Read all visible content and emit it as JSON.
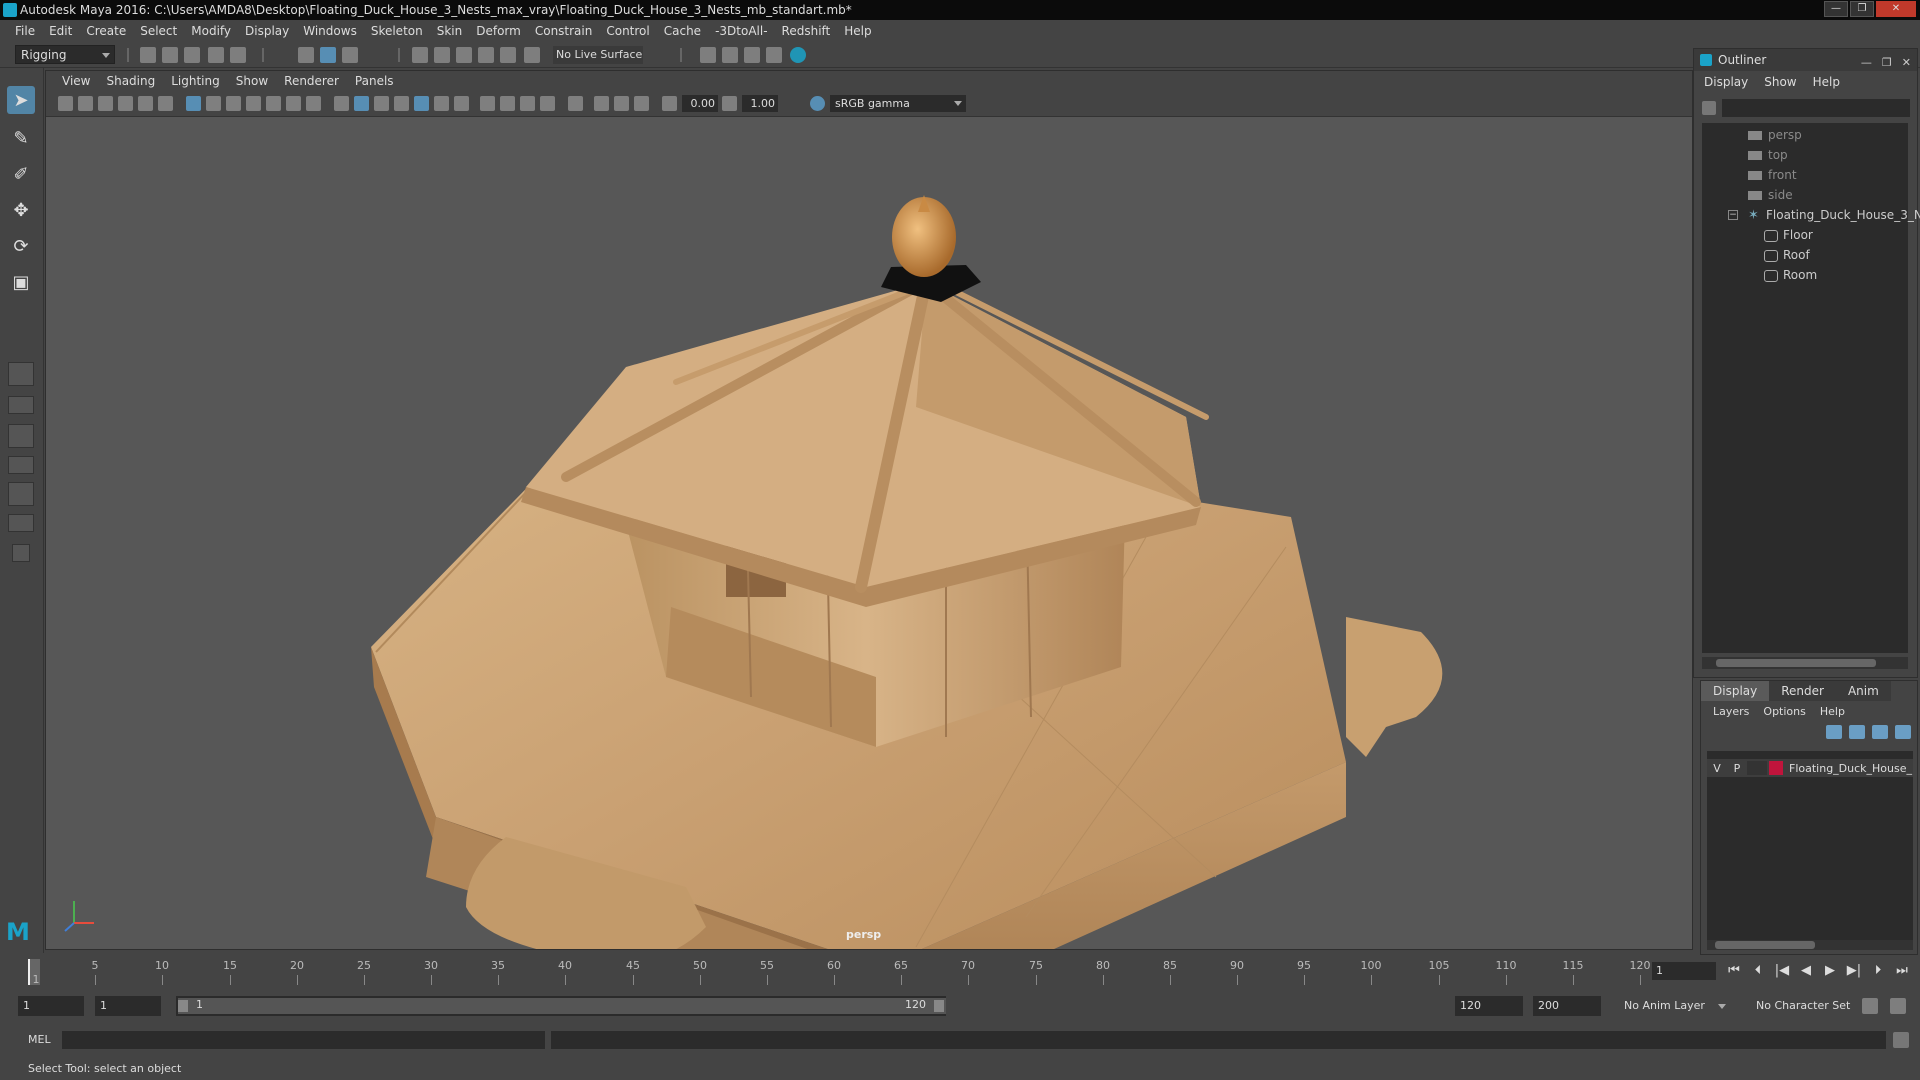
{
  "window": {
    "title": "Autodesk Maya 2016: C:\\Users\\AMDA8\\Desktop\\Floating_Duck_House_3_Nests_max_vray\\Floating_Duck_House_3_Nests_mb_standart.mb*",
    "minimize": "—",
    "maximize": "❐",
    "close": "✕"
  },
  "menubar": [
    "File",
    "Edit",
    "Create",
    "Select",
    "Modify",
    "Display",
    "Windows",
    "Skeleton",
    "Skin",
    "Deform",
    "Constrain",
    "Control",
    "Cache",
    "-3DtoAll-",
    "Redshift",
    "Help"
  ],
  "shelf": {
    "mode": "Rigging",
    "live_surface": "No Live Surface"
  },
  "viewport": {
    "menu": [
      "View",
      "Shading",
      "Lighting",
      "Show",
      "Renderer",
      "Panels"
    ],
    "exposure": "0.00",
    "gamma_value": "1.00",
    "color_space": "sRGB gamma",
    "camera": "persp"
  },
  "outliner": {
    "title": "Outliner",
    "menu": [
      "Display",
      "Show",
      "Help"
    ],
    "cameras": [
      "persp",
      "top",
      "front",
      "side"
    ],
    "group": "Floating_Duck_House_3_N",
    "children": [
      "Floor",
      "Roof",
      "Room"
    ]
  },
  "layers": {
    "tabs": [
      "Display",
      "Render",
      "Anim"
    ],
    "menu": [
      "Layers",
      "Options",
      "Help"
    ],
    "layer_v": "V",
    "layer_p": "P",
    "layer_name": "Floating_Duck_House_",
    "layer_color": "#c0143c"
  },
  "timeline": {
    "ticks": [
      "5",
      "10",
      "15",
      "20",
      "25",
      "30",
      "35",
      "40",
      "45",
      "50",
      "55",
      "60",
      "65",
      "70",
      "75",
      "80",
      "85",
      "90",
      "95",
      "100",
      "105",
      "110",
      "115",
      "120"
    ],
    "start_tick": "1",
    "current_frame": "1",
    "playback": [
      "⏮",
      "⏴",
      "|◀",
      "◀",
      "▶",
      "▶|",
      "⏵",
      "⏭"
    ]
  },
  "range": {
    "start": "1",
    "anim_start": "1",
    "slider_start": "1",
    "slider_end": "120",
    "end": "120",
    "anim_end": "200",
    "anim_layer": "No Anim Layer",
    "char_set": "No Character Set"
  },
  "command": {
    "label": "MEL"
  },
  "help": {
    "text": "Select Tool: select an object"
  }
}
